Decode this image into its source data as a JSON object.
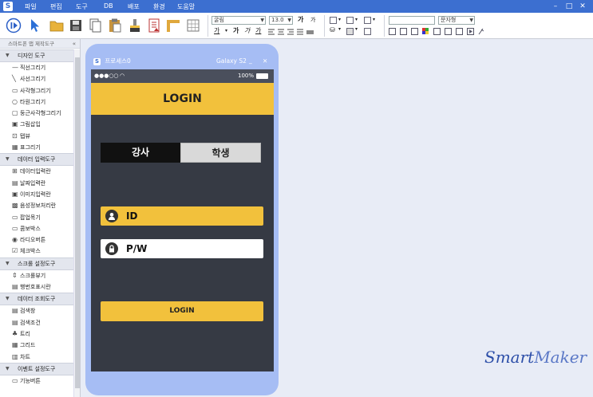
{
  "menubar": {
    "items": [
      "파일",
      "편집",
      "도구",
      "DB",
      "배포",
      "환경",
      "도움말"
    ],
    "logo": "S"
  },
  "toolbar": {
    "font_name": "굴림",
    "font_size": "13.0",
    "style_select": "문자형",
    "font_style_labels": [
      "가",
      "가",
      "가",
      "가"
    ]
  },
  "sidebar": {
    "header": "스마트폰 앱 제작도구",
    "sections": [
      {
        "title": "디자인 도구",
        "items": [
          "직선그리기",
          "사선그리기",
          "사각형그리기",
          "타원그리기",
          "둥근사각형그리기",
          "그림삽입",
          "탭뷰",
          "표그리기"
        ]
      },
      {
        "title": "데이터 입력도구",
        "items": [
          "데이터입력란",
          "날짜입력란",
          "이미지입력란",
          "음성정보처리란",
          "팝업목기",
          "콤보박스",
          "라디오버튼",
          "체크박스"
        ]
      },
      {
        "title": "스크롤 설정도구",
        "items": [
          "스크롤뷰기",
          "행번호표시란"
        ]
      },
      {
        "title": "데이터 조회도구",
        "items": [
          "검색창",
          "검색조건",
          "트리",
          "그리드",
          "차트"
        ]
      },
      {
        "title": "이벤트 설정도구",
        "items": [
          "기능버튼"
        ]
      }
    ]
  },
  "phone": {
    "title": "프로세스0",
    "device": "Galaxy S2",
    "status_left": "●●●○○",
    "battery": "100%",
    "header_title": "LOGIN",
    "tab_teacher": "강사",
    "tab_student": "학생",
    "id_label": "ID",
    "pw_label": "P/W",
    "login_button": "LOGIN"
  },
  "brand": {
    "smart": "Smart",
    "maker": "Maker"
  },
  "colors": {
    "menubar": "#3c6fd0",
    "phone_frame": "#a6bdf4",
    "screen": "#363a44",
    "accent": "#f2c13c"
  }
}
